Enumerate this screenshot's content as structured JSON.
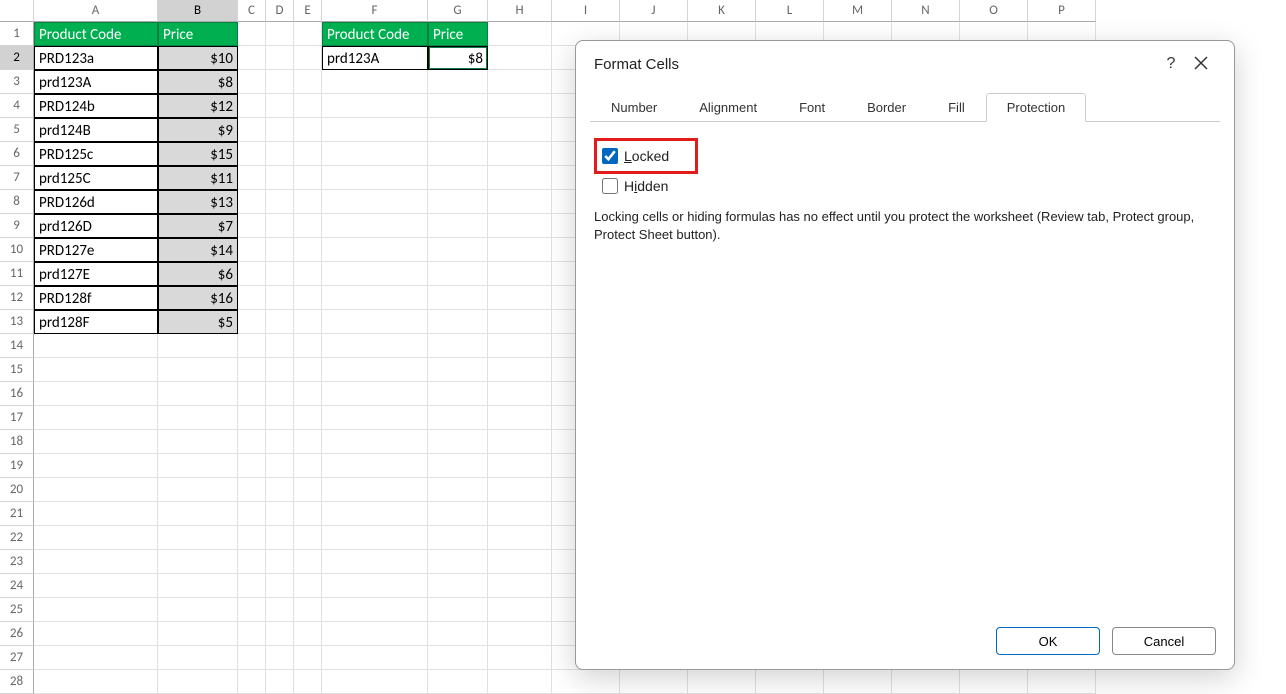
{
  "columns": [
    "A",
    "B",
    "C",
    "D",
    "E",
    "F",
    "G",
    "H",
    "I",
    "J",
    "K",
    "L",
    "M",
    "N",
    "O",
    "P"
  ],
  "selected_col": "B",
  "table1": {
    "headers": {
      "code": "Product Code",
      "price": "Price"
    },
    "rows": [
      {
        "code": "PRD123a",
        "price": "$10"
      },
      {
        "code": "prd123A",
        "price": "$8"
      },
      {
        "code": "PRD124b",
        "price": "$12"
      },
      {
        "code": "prd124B",
        "price": "$9"
      },
      {
        "code": "PRD125c",
        "price": "$15"
      },
      {
        "code": "prd125C",
        "price": "$11"
      },
      {
        "code": "PRD126d",
        "price": "$13"
      },
      {
        "code": "prd126D",
        "price": "$7"
      },
      {
        "code": "PRD127e",
        "price": "$14"
      },
      {
        "code": "prd127E",
        "price": "$6"
      },
      {
        "code": "PRD128f",
        "price": "$16"
      },
      {
        "code": "prd128F",
        "price": "$5"
      }
    ]
  },
  "table2": {
    "headers": {
      "code": "Product Code",
      "price": "Price"
    },
    "rows": [
      {
        "code": "prd123A",
        "price": "$8"
      }
    ]
  },
  "rows_total": 28,
  "dialog": {
    "title": "Format Cells",
    "help": "?",
    "tabs": [
      "Number",
      "Alignment",
      "Font",
      "Border",
      "Fill",
      "Protection"
    ],
    "active_tab": "Protection",
    "locked_label_pre": "L",
    "locked_label_post": "ocked",
    "locked_checked": true,
    "hidden_label_pre": "H",
    "hidden_label_rest": "idden",
    "hidden_checked": false,
    "info": "Locking cells or hiding formulas has no effect until you protect the worksheet (Review tab, Protect group, Protect Sheet button).",
    "ok": "OK",
    "cancel": "Cancel"
  }
}
